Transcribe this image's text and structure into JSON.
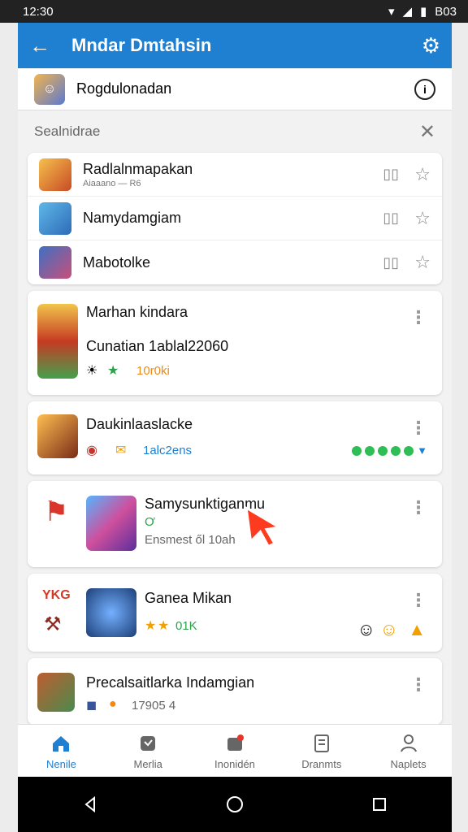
{
  "status": {
    "time": "12:30",
    "battery": "B03"
  },
  "app_bar": {
    "title": "Mndar Dmtahsin"
  },
  "top_item": {
    "label": "Rogdulonadan"
  },
  "section": {
    "title": "Sealnidrae"
  },
  "compact_items": [
    {
      "title": "Radlalnmapakan",
      "sub": "Aiaaano — R6",
      "icon_color": "#c84b24"
    },
    {
      "title": "Namydamgiam",
      "sub": "",
      "icon_color": "#2d6bb8"
    },
    {
      "title": "Mabotolke",
      "sub": "",
      "icon_color": "#375f99"
    }
  ],
  "cards": [
    {
      "title": "Marhan kindara",
      "subtitle": "Cunatian 1ablal22060",
      "meta": "10r0ki",
      "icons": [
        "sun",
        "star"
      ],
      "color": "#d36a29"
    },
    {
      "title": "Daukinlaaslacke",
      "meta": "1alc2ens",
      "icons": [
        "mask",
        "mail"
      ],
      "color": "#b84d2b"
    },
    {
      "title": "Samysunktiganmu",
      "subtitle": "Ơ",
      "meta": "Ensmest ől 10ah",
      "color": "#8a4ccf"
    },
    {
      "title": "Ganea Mikan",
      "meta": "01K",
      "icons": [
        "star",
        "star"
      ],
      "color": "#2b4f8a"
    },
    {
      "title": "Precalsaitlarka Indamgian",
      "meta": "17905 4",
      "icons": [
        "badge",
        "coin"
      ],
      "color": "#b06a3c"
    }
  ],
  "side_labels": [
    "YKG"
  ],
  "bottom_nav": [
    {
      "label": "Nenile",
      "active": true
    },
    {
      "label": "Merlia",
      "active": false
    },
    {
      "label": "Inonidén",
      "active": false
    },
    {
      "label": "Dranmts",
      "active": false
    },
    {
      "label": "Naplets",
      "active": false
    }
  ]
}
